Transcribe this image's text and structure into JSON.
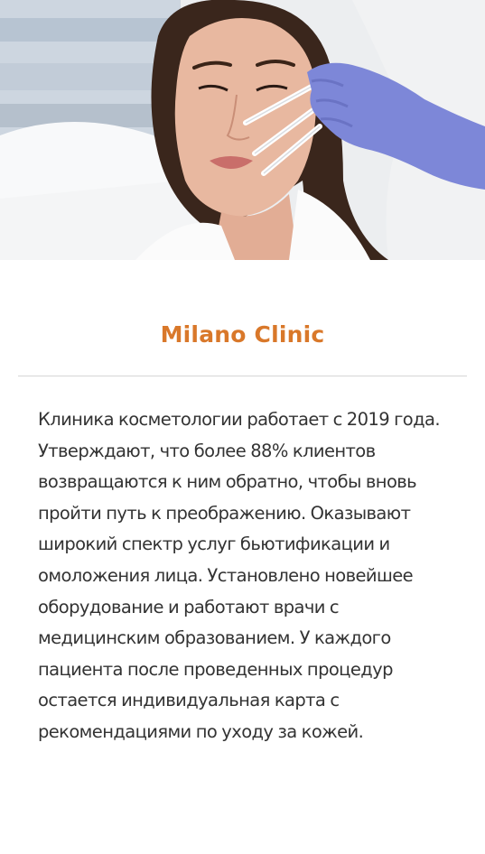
{
  "clinic": {
    "name": "Milano Clinic",
    "description": "Клиника косметологии работает с 2019 года. Утверждают, что более 88% клиентов возвращаются к ним обратно, чтобы вновь пройти путь к преображению. Оказывают широкий спектр услуг бьютификации и омоложения лица. Установлено новейшее оборудование и работают врачи с медицинским образованием. У каждого пациента после проведенных процедур остается индивидуальная карта с рекомендациями по уходу за кожей."
  },
  "colors": {
    "accent": "#d9782a",
    "text": "#333333",
    "divider": "#d6d6d6",
    "glove": "#7d87d8"
  }
}
